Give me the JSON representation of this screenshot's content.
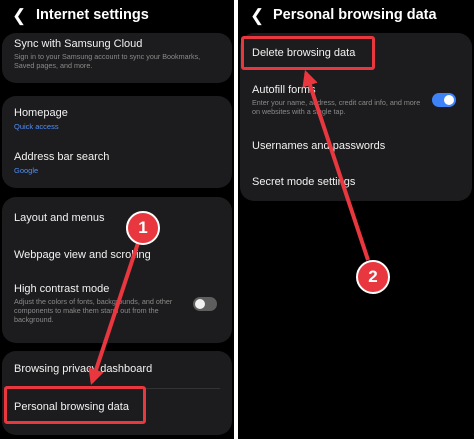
{
  "left": {
    "header": {
      "back_icon": "chevron-left-icon",
      "title": "Internet settings"
    },
    "sync": {
      "label": "Sync with Samsung Cloud",
      "desc": "Sign in to your Samsung account to sync your Bookmarks, Saved pages, and more."
    },
    "homepage": {
      "label": "Homepage",
      "value": "Quick access"
    },
    "address_bar": {
      "label": "Address bar search",
      "value": "Google"
    },
    "layout_menus": {
      "label": "Layout and menus"
    },
    "webpage_view": {
      "label": "Webpage view and scrolling"
    },
    "high_contrast": {
      "label": "High contrast mode",
      "desc": "Adjust the colors of fonts, backgrounds, and other components to make them stand out from the background.",
      "enabled": false
    },
    "privacy_dashboard": {
      "label": "Browsing privacy dashboard"
    },
    "personal_data": {
      "label": "Personal browsing data"
    }
  },
  "right": {
    "header": {
      "back_icon": "chevron-left-icon",
      "title": "Personal browsing data"
    },
    "delete_data": {
      "label": "Delete browsing data"
    },
    "autofill": {
      "label": "Autofill forms",
      "desc": "Enter your name, address, credit card info, and more on websites with a single tap.",
      "enabled": true
    },
    "usernames": {
      "label": "Usernames and passwords"
    },
    "secret_mode": {
      "label": "Secret mode settings"
    }
  },
  "annotations": {
    "step1": "1",
    "step2": "2",
    "color": "#e8373f"
  }
}
